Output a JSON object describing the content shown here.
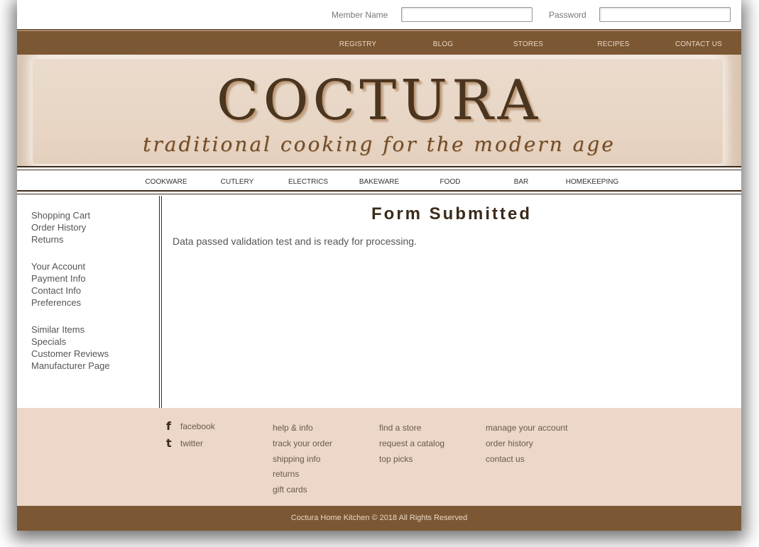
{
  "login": {
    "member_label": "Member Name",
    "member_value": "",
    "password_label": "Password",
    "password_value": ""
  },
  "top_nav": [
    "REGISTRY",
    "BLOG",
    "STORES",
    "RECIPES",
    "CONTACT US"
  ],
  "banner": {
    "brand": "COCTURA",
    "tagline": "traditional cooking for the modern age"
  },
  "categories": [
    "COOKWARE",
    "CUTLERY",
    "ELECTRICS",
    "BAKEWARE",
    "FOOD",
    "BAR",
    "HOMEKEEPING"
  ],
  "sidebar": {
    "group1": [
      "Shopping Cart",
      "Order History",
      "Returns"
    ],
    "group2": [
      "Your Account",
      "Payment Info",
      "Contact Info",
      "Preferences"
    ],
    "group3": [
      "Similar Items",
      "Specials",
      "Customer Reviews",
      "Manufacturer Page"
    ]
  },
  "main": {
    "title": "Form Submitted",
    "message": "Data passed validation test and is ready for processing."
  },
  "footer": {
    "social": [
      {
        "icon": "facebook-icon",
        "label": "facebook"
      },
      {
        "icon": "twitter-icon",
        "label": "twitter"
      }
    ],
    "col1": [
      "help & info",
      "track your order",
      "shipping info",
      "returns",
      "gift cards"
    ],
    "col2": [
      "find a store",
      "request a catalog",
      "top picks"
    ],
    "col3": [
      "manage your account",
      "order history",
      "contact us"
    ],
    "copyright": "Coctura Home Kitchen © 2018 All Rights Reserved"
  },
  "colors": {
    "brown": "#7b5733",
    "footer_bg": "#ecd7c8",
    "banner_bg": "#ead8c8",
    "dark": "#3b2a1a"
  }
}
